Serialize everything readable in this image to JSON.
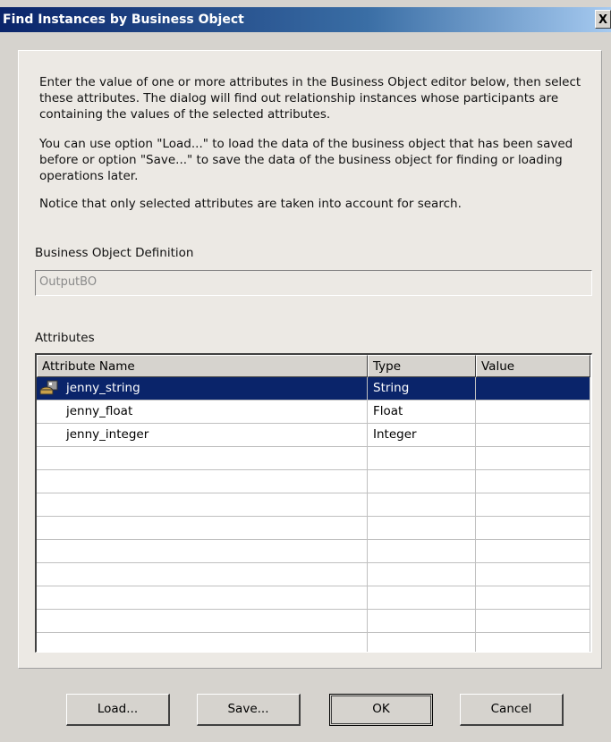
{
  "window": {
    "title": "Find Instances by Business Object",
    "close_label": "X"
  },
  "description": {
    "p1": "Enter the value of one or more attributes in the Business Object editor below, then select these attributes. The dialog will find out relationship instances whose participants are containing the values of the selected attributes.",
    "p2": "You can use option \"Load...\" to load the data of the business object that has been saved before or option \"Save...\" to save the data of the business object for finding or loading operations later.",
    "p3": "Notice that only selected attributes are taken into account for search."
  },
  "bo_definition": {
    "label": "Business Object Definition",
    "value": "OutputBO"
  },
  "attributes": {
    "label": "Attributes",
    "columns": [
      "Attribute Name",
      "Type",
      "Value"
    ],
    "rows": [
      {
        "name": "jenny_string",
        "type": "String",
        "value": "",
        "selected": true,
        "icon": "business-object-icon"
      },
      {
        "name": "jenny_float",
        "type": "Float",
        "value": ""
      },
      {
        "name": "jenny_integer",
        "type": "Integer",
        "value": ""
      }
    ],
    "empty_rows": 9
  },
  "buttons": {
    "load": "Load...",
    "save": "Save...",
    "ok": "OK",
    "cancel": "Cancel"
  },
  "colors": {
    "selection": "#0a246a",
    "title_bar": "#0a246a",
    "dialog_bg": "#d6d3ce"
  }
}
